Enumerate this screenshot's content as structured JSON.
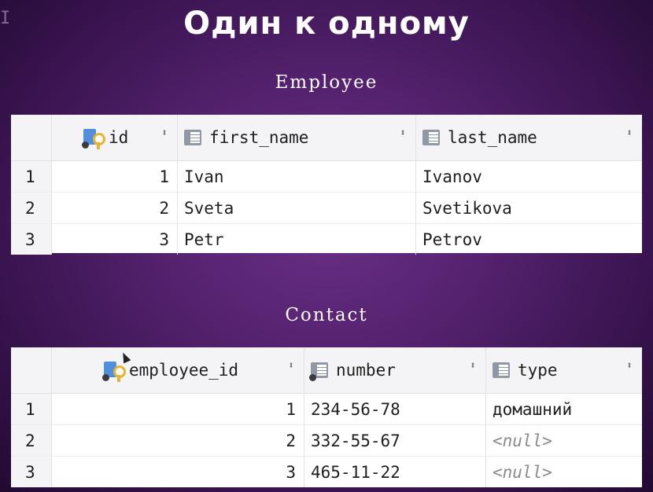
{
  "slide": {
    "title": "Один к одному"
  },
  "employee": {
    "caption": "Employee",
    "columns": [
      {
        "label": "id",
        "icon": "primary-key-column-icon"
      },
      {
        "label": "first_name",
        "icon": "column-icon"
      },
      {
        "label": "last_name",
        "icon": "column-icon"
      }
    ],
    "rows": [
      {
        "n": "1",
        "id": "1",
        "first_name": "Ivan",
        "last_name": "Ivanov"
      },
      {
        "n": "2",
        "id": "2",
        "first_name": "Sveta",
        "last_name": "Svetikova"
      },
      {
        "n": "3",
        "id": "3",
        "first_name": "Petr",
        "last_name": "Petrov"
      }
    ]
  },
  "contact": {
    "caption": "Contact",
    "columns": [
      {
        "label": "employee_id",
        "icon": "primary-key-column-icon"
      },
      {
        "label": "number",
        "icon": "column-icon"
      },
      {
        "label": "type",
        "icon": "column-icon"
      }
    ],
    "rows": [
      {
        "n": "1",
        "employee_id": "1",
        "number": "234-56-78",
        "type": "домашний"
      },
      {
        "n": "2",
        "employee_id": "2",
        "number": "332-55-67",
        "type": "<null>"
      },
      {
        "n": "3",
        "employee_id": "3",
        "number": "465-11-22",
        "type": "<null>"
      }
    ]
  },
  "sort_glyph": "⬍"
}
